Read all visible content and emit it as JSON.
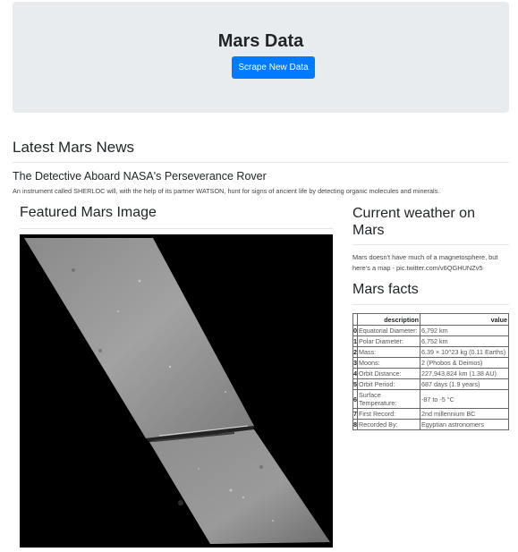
{
  "header": {
    "title": "Mars Data",
    "scrape_button_label": "Scrape New Data"
  },
  "news": {
    "section_title": "Latest Mars News",
    "headline": "The Detective Aboard NASA's Perseverance Rover",
    "teaser": "An instrument called SHERLOC will, with the help of its partner WATSON, hunt for signs of ancient life by detecting organic molecules and minerals."
  },
  "featured_image": {
    "section_title": "Featured Mars Image"
  },
  "weather": {
    "section_title": "Current weather on Mars",
    "text": "Mars doesn't have much of a magnetosphere, but here's a map - pic.twitter.com/v6QGHUNZv5"
  },
  "facts": {
    "section_title": "Mars facts",
    "columns": [
      "",
      "description",
      "value"
    ],
    "rows": [
      {
        "index": "0",
        "description": "Equatorial Diameter:",
        "value": "6,792 km"
      },
      {
        "index": "1",
        "description": "Polar Diameter:",
        "value": "6,752 km"
      },
      {
        "index": "2",
        "description": "Mass:",
        "value": "6.39 × 10^23 kg (0.11 Earths)"
      },
      {
        "index": "3",
        "description": "Moons:",
        "value": "2 (Phobos & Deimos)"
      },
      {
        "index": "4",
        "description": "Orbit Distance:",
        "value": "227,943,824 km (1.38 AU)"
      },
      {
        "index": "5",
        "description": "Orbit Period:",
        "value": "687 days (1.9 years)"
      },
      {
        "index": "6",
        "description": "Surface Temperature:",
        "value": "-87 to -5 °C"
      },
      {
        "index": "7",
        "description": "First Record:",
        "value": "2nd millennium BC"
      },
      {
        "index": "8",
        "description": "Recorded By:",
        "value": "Egyptian astronomers"
      }
    ]
  }
}
